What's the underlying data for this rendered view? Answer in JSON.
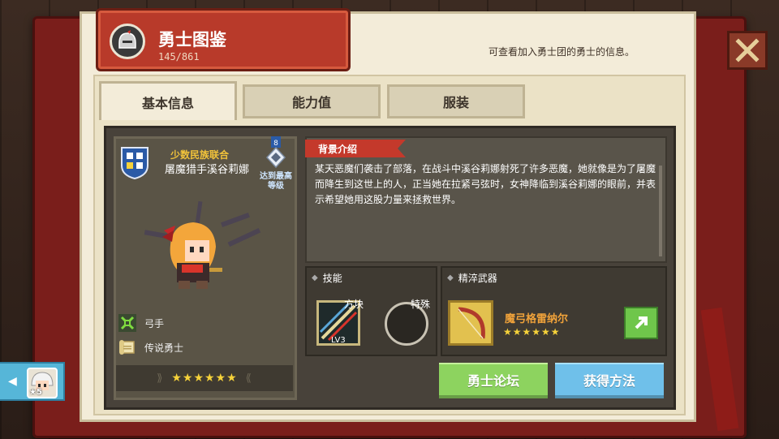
{
  "header": {
    "title": "勇士图鉴",
    "count": "145/861",
    "subtitle": "可查看加入勇士团的勇士的信息。"
  },
  "tabs": [
    {
      "label": "基本信息",
      "active": true
    },
    {
      "label": "能力值",
      "active": false
    },
    {
      "label": "服装",
      "active": false
    }
  ],
  "hero": {
    "faction": "少数民族联合",
    "name": "屠魔猎手溪谷莉娜",
    "max_badge_number": "8",
    "max_badge_text": "达到最高等级",
    "class_label": "弓手",
    "rank_label": "传说勇士",
    "stars": "★★★★★★"
  },
  "background": {
    "tag": "背景介绍",
    "text": "某天恶魔们袭击了部落，在战斗中溪谷莉娜射死了许多恶魔，她就像是为了屠魔而降生到这世上的人，正当她在拉紧弓弦时，女神降临到溪谷莉娜的眼前，并表示希望她用这股力量来拯救世界。"
  },
  "skills": {
    "title": "技能",
    "skill_name": "方块",
    "skill_level": "LV3",
    "special_label": "特殊"
  },
  "weapon": {
    "title": "精淬武器",
    "name": "魔弓格雷纳尔",
    "stars": "★★★★★★"
  },
  "buttons": {
    "forum": "勇士论坛",
    "obtain": "获得方法"
  },
  "side_tab": {
    "level": "5"
  },
  "colors": {
    "accent_red": "#c4392b",
    "star_gold": "#f6d23a",
    "btn_green": "#8dd35f",
    "btn_blue": "#6fc0ea"
  }
}
